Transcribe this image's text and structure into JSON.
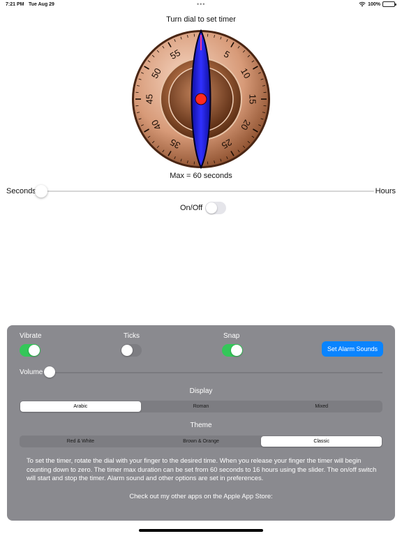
{
  "status": {
    "time": "7:21 PM",
    "date": "Tue Aug 29",
    "battery": "100%",
    "more_dots": "•••"
  },
  "dial": {
    "title": "Turn dial to set timer",
    "numbers": [
      "5",
      "10",
      "15",
      "20",
      "25",
      "30",
      "35",
      "40",
      "45",
      "50",
      "55"
    ],
    "max_label": "Max = 60 seconds",
    "colors": {
      "hand": "#1f1fe0",
      "center": "#ff2a1f",
      "rim": "#e8b79a",
      "face": "#9a5a32"
    }
  },
  "range": {
    "left_label": "Seconds",
    "right_label": "Hours",
    "value": 0
  },
  "timer_switch": {
    "label": "On/Off",
    "on": false
  },
  "prefs": {
    "vibrate": {
      "label": "Vibrate",
      "on": true
    },
    "ticks": {
      "label": "Ticks",
      "on": false
    },
    "snap": {
      "label": "Snap",
      "on": true
    },
    "alarm_button": "Set Alarm Sounds",
    "volume": {
      "label": "Volume",
      "value": 0
    },
    "display": {
      "title": "Display",
      "options": [
        "Arabic",
        "Roman",
        "Mixed"
      ],
      "selected": "Arabic"
    },
    "theme": {
      "title": "Theme",
      "options": [
        "Red & White",
        "Brown & Orange",
        "Classic"
      ],
      "selected": "Classic"
    },
    "help_text": "To set the timer, rotate the dial with your finger to the desired time.  When you release your finger the timer will begin counting down to zero.  The timer max duration can be set from 60 seconds to 16 hours using the slider.  The on/off switch will start and stop the timer.  Alarm sound and other options are set in preferences.",
    "store_text": "Check out my other apps on the Apple App Store:"
  },
  "colors": {
    "accent": "#0a84ff",
    "switch_on": "#34c759",
    "panel": "#8a8a8f"
  }
}
